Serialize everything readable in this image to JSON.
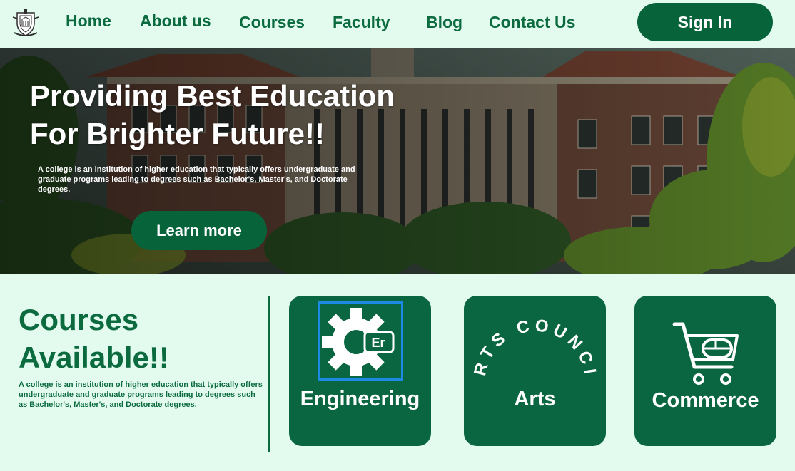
{
  "nav": {
    "links": [
      "Home",
      "About us",
      "Courses",
      "Faculty",
      "Blog",
      "Contact Us"
    ],
    "signin_label": "Sign In"
  },
  "hero": {
    "title_line1": "Providing Best Education",
    "title_line2": "For Brighter Future!!",
    "description": "A college is an institution of higher education that typically offers undergraduate and graduate programs leading to degrees such as Bachelor's, Master's, and Doctorate degrees.",
    "cta_label": "Learn more"
  },
  "courses": {
    "title_line1": "Courses",
    "title_line2": "Available!!",
    "description": "A college is an institution of higher education that typically offers undergraduate and graduate programs leading to degrees such as Bachelor's, Master's, and Doctorate degrees.",
    "cards": [
      {
        "label": "Engineering",
        "icon": "gear-wrench-icon",
        "badge": "Er"
      },
      {
        "label": "Arts",
        "icon": "arts-council-icon",
        "arc_text": "ARTS COUNCIL"
      },
      {
        "label": "Commerce",
        "icon": "shopping-cart-icon"
      }
    ]
  },
  "colors": {
    "primary": "#07633a",
    "text_green": "#0b6b3f",
    "background": "#e3fbef",
    "engineering_frame": "#1e88e5"
  }
}
